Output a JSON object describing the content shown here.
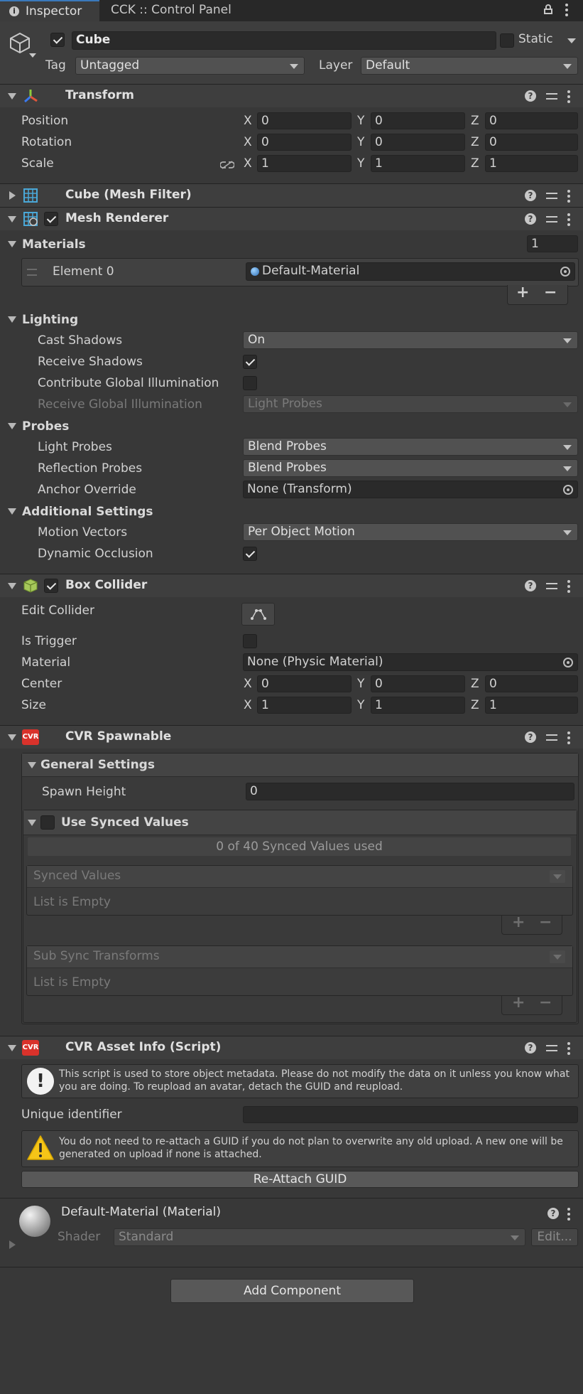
{
  "tabs": {
    "inspector": "Inspector",
    "control_panel": "CCK :: Control Panel"
  },
  "object": {
    "name": "Cube",
    "static_label": "Static",
    "tag_label": "Tag",
    "tag_value": "Untagged",
    "layer_label": "Layer",
    "layer_value": "Default"
  },
  "transform": {
    "title": "Transform",
    "position_label": "Position",
    "rotation_label": "Rotation",
    "scale_label": "Scale",
    "axis_x": "X",
    "axis_y": "Y",
    "axis_z": "Z",
    "position": {
      "x": "0",
      "y": "0",
      "z": "0"
    },
    "rotation": {
      "x": "0",
      "y": "0",
      "z": "0"
    },
    "scale": {
      "x": "1",
      "y": "1",
      "z": "1"
    }
  },
  "mesh_filter": {
    "title": "Cube (Mesh Filter)"
  },
  "mesh_renderer": {
    "title": "Mesh Renderer",
    "materials_label": "Materials",
    "materials_count": "1",
    "element0_label": "Element 0",
    "element0_value": "Default-Material",
    "lighting_label": "Lighting",
    "cast_shadows_label": "Cast Shadows",
    "cast_shadows_value": "On",
    "receive_shadows_label": "Receive Shadows",
    "contribute_gi_label": "Contribute Global Illumination",
    "receive_gi_label": "Receive Global Illumination",
    "receive_gi_value": "Light Probes",
    "probes_label": "Probes",
    "light_probes_label": "Light Probes",
    "light_probes_value": "Blend Probes",
    "reflection_probes_label": "Reflection Probes",
    "reflection_probes_value": "Blend Probes",
    "anchor_override_label": "Anchor Override",
    "anchor_override_value": "None (Transform)",
    "additional_label": "Additional Settings",
    "motion_vectors_label": "Motion Vectors",
    "motion_vectors_value": "Per Object Motion",
    "dynamic_occlusion_label": "Dynamic Occlusion"
  },
  "box_collider": {
    "title": "Box Collider",
    "edit_collider_label": "Edit Collider",
    "is_trigger_label": "Is Trigger",
    "material_label": "Material",
    "material_value": "None (Physic Material)",
    "center_label": "Center",
    "size_label": "Size",
    "center": {
      "x": "0",
      "y": "0",
      "z": "0"
    },
    "size": {
      "x": "1",
      "y": "1",
      "z": "1"
    }
  },
  "cvr_spawnable": {
    "title": "CVR Spawnable",
    "general_settings": "General Settings",
    "spawn_height_label": "Spawn Height",
    "spawn_height_value": "0",
    "use_synced_values": "Use Synced Values",
    "synced_count": "0 of 40 Synced Values used",
    "synced_values_label": "Synced Values",
    "list_empty_1": "List is Empty",
    "sub_sync_label": "Sub Sync Transforms",
    "list_empty_2": "List is Empty"
  },
  "cvr_asset_info": {
    "title": "CVR Asset Info (Script)",
    "info_text": "This script is used to store object metadata. Please do not modify the data on it unless you know what you are doing. To reupload an avatar, detach the GUID and reupload.",
    "unique_identifier_label": "Unique identifier",
    "unique_identifier_value": "",
    "warning_text": "You do not need to re-attach a GUID if you do not plan to overwrite any old upload. A new one will be generated on upload if none is attached.",
    "reattach_button": "Re-Attach GUID"
  },
  "material": {
    "title": "Default-Material (Material)",
    "shader_label": "Shader",
    "shader_value": "Standard",
    "edit_button": "Edit..."
  },
  "add_component": "Add Component",
  "colors": {
    "background": "#383838",
    "header": "#3e3e3e",
    "field": "#2a2a2a",
    "dropdown": "#515151",
    "cvr_red": "#d9322b"
  }
}
